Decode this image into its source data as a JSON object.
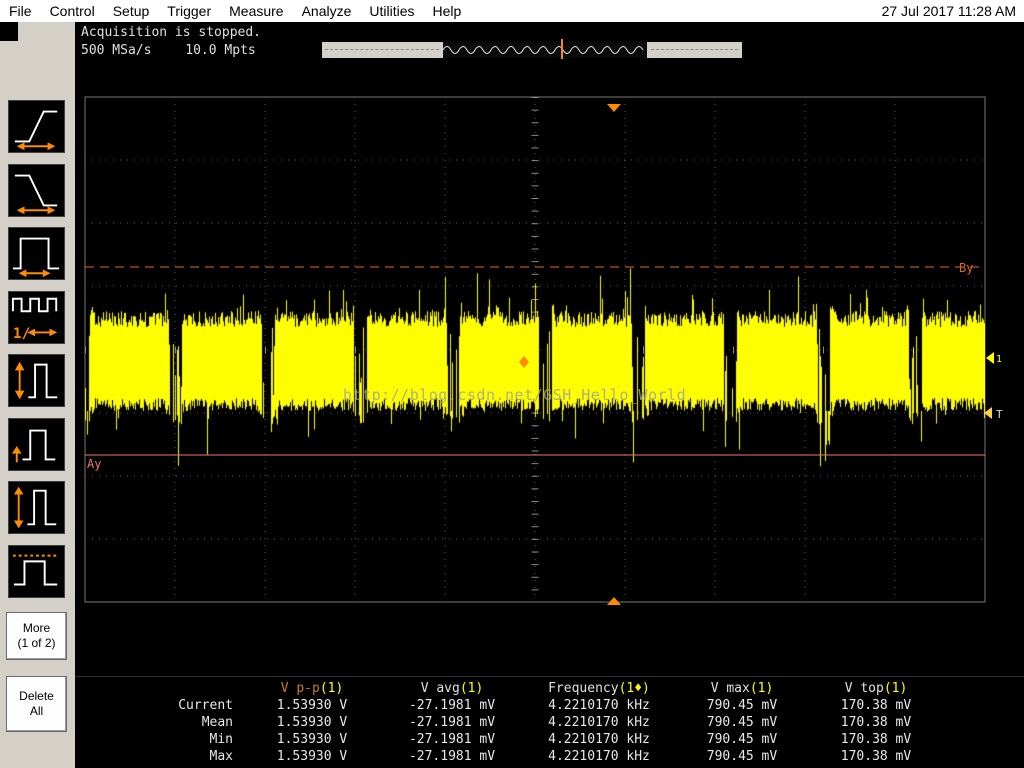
{
  "menu": {
    "items": [
      "File",
      "Control",
      "Setup",
      "Trigger",
      "Measure",
      "Analyze",
      "Utilities",
      "Help"
    ],
    "clock": "27 Jul 2017 11:28 AM"
  },
  "status": {
    "acquisition": "Acquisition is stopped.",
    "sample_rate": "500 MSa/s",
    "memory_depth": "10.0 Mpts"
  },
  "sidebar": {
    "more_label": "More",
    "more_sub": "(1 of 2)",
    "delete_label": "Delete",
    "delete_sub": "All"
  },
  "scope": {
    "marker_b": "By",
    "marker_a": "Ay",
    "channel_label": "1",
    "trigger_label": "T",
    "watermark": "http://blog.csdn.net/GSH_Hello_World",
    "colors": {
      "trace": "#ffff00",
      "trigger": "#ff8c00",
      "marker_a": "#f07474",
      "marker_b": "#e06820"
    }
  },
  "measurements": {
    "columns": [
      {
        "name": "V p-p",
        "ch": "(1)"
      },
      {
        "name": "V avg",
        "ch": "(1)"
      },
      {
        "name": "Frequency",
        "ch": "(1♦)"
      },
      {
        "name": "V max",
        "ch": "(1)"
      },
      {
        "name": "V top",
        "ch": "(1)"
      }
    ],
    "rows": [
      {
        "label": "Current",
        "values": [
          "1.53930 V",
          "-27.1981 mV",
          "4.2210170 kHz",
          "790.45 mV",
          "170.38 mV"
        ]
      },
      {
        "label": "Mean",
        "values": [
          "1.53930 V",
          "-27.1981 mV",
          "4.2210170 kHz",
          "790.45 mV",
          "170.38 mV"
        ]
      },
      {
        "label": "Min",
        "values": [
          "1.53930 V",
          "-27.1981 mV",
          "4.2210170 kHz",
          "790.45 mV",
          "170.38 mV"
        ]
      },
      {
        "label": "Max",
        "values": [
          "1.53930 V",
          "-27.1981 mV",
          "4.2210170 kHz",
          "790.45 mV",
          "170.38 mV"
        ]
      }
    ]
  }
}
